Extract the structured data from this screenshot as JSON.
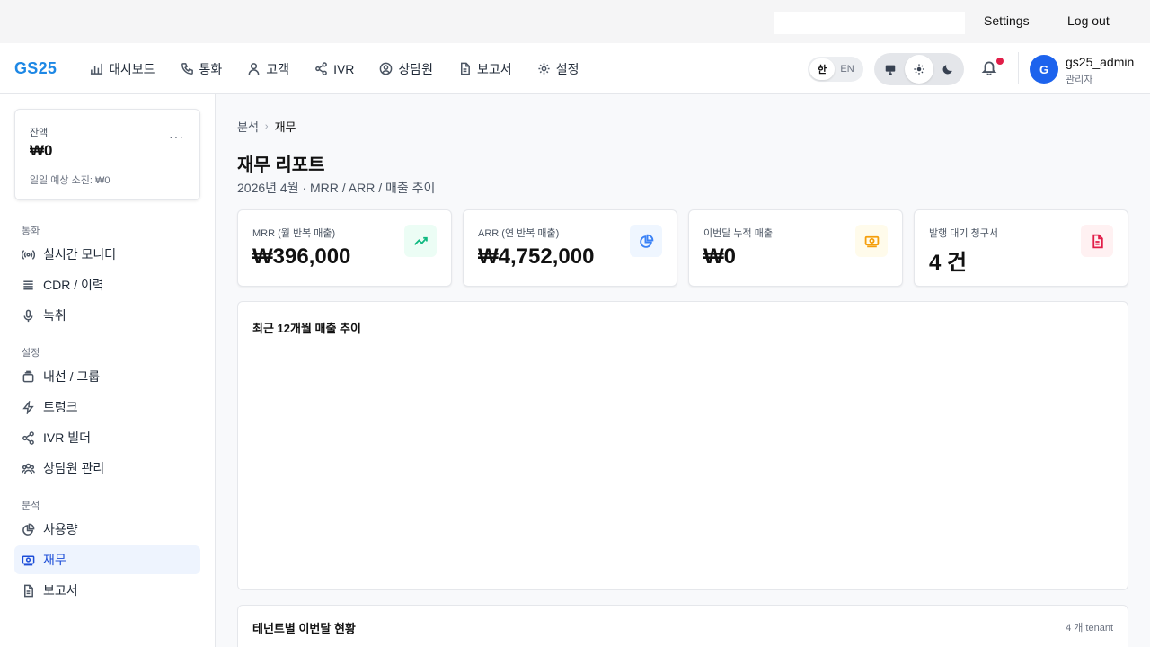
{
  "topbar": {
    "settings_label": "Settings",
    "logout_label": "Log out"
  },
  "header": {
    "brand": "GS25",
    "nav": [
      {
        "label": "대시보드",
        "icon": "bar-chart-icon"
      },
      {
        "label": "통화",
        "icon": "phone-icon"
      },
      {
        "label": "고객",
        "icon": "user-icon"
      },
      {
        "label": "IVR",
        "icon": "share-icon"
      },
      {
        "label": "상담원",
        "icon": "user-circle-icon"
      },
      {
        "label": "보고서",
        "icon": "file-icon"
      },
      {
        "label": "설정",
        "icon": "gear-icon"
      }
    ],
    "lang": {
      "ko": "한",
      "en": "EN",
      "active": "ko"
    },
    "theme": {
      "active": "light",
      "options": [
        "monitor-icon",
        "sun-icon",
        "moon-icon"
      ]
    },
    "notifications": {
      "has_unread": true
    },
    "user": {
      "initial": "G",
      "name": "gs25_admin",
      "role": "관리자"
    }
  },
  "sidebar": {
    "balance": {
      "label": "잔액",
      "value": "₩0",
      "sub": "일일 예상 소진: ₩0",
      "more": "···"
    },
    "sections": [
      {
        "title": "통화",
        "items": [
          {
            "label": "실시간 모니터",
            "icon": "broadcast-icon"
          },
          {
            "label": "CDR / 이력",
            "icon": "list-icon"
          },
          {
            "label": "녹취",
            "icon": "mic-icon"
          }
        ]
      },
      {
        "title": "설정",
        "items": [
          {
            "label": "내선 / 그룹",
            "icon": "layers-icon"
          },
          {
            "label": "트렁크",
            "icon": "zap-icon"
          },
          {
            "label": "IVR 빌더",
            "icon": "share-icon"
          },
          {
            "label": "상담원 관리",
            "icon": "users-icon"
          }
        ]
      },
      {
        "title": "분석",
        "items": [
          {
            "label": "사용량",
            "icon": "pie-icon"
          },
          {
            "label": "재무",
            "icon": "money-icon",
            "active": true
          },
          {
            "label": "보고서",
            "icon": "file-icon"
          }
        ]
      }
    ]
  },
  "main": {
    "breadcrumb": {
      "parent": "분석",
      "current": "재무"
    },
    "title": "재무 리포트",
    "subtitle": "2026년 4월 · MRR / ARR / 매출 추이",
    "kpis": [
      {
        "label": "MRR (월 반복 매출)",
        "value": "₩396,000",
        "icon": "trending-up-icon",
        "accent": "#10b981",
        "bg": "#ecfdf5"
      },
      {
        "label": "ARR (연 반복 매출)",
        "value": "₩4,752,000",
        "icon": "pie-chart-icon",
        "accent": "#3b82f6",
        "bg": "#eff6ff"
      },
      {
        "label": "이번달 누적 매출",
        "value": "₩0",
        "icon": "banknote-icon",
        "accent": "#f59e0b",
        "bg": "#fffbeb"
      },
      {
        "label": "발행 대기 청구서",
        "value": "4 건",
        "icon": "invoice-icon",
        "accent": "#e11d48",
        "bg": "#fff1f2"
      }
    ],
    "chart_card": {
      "title": "최근 12개월 매출 추이"
    },
    "tenant_card": {
      "title": "테넌트별 이번달 현황",
      "count": "4 개 tenant"
    }
  }
}
